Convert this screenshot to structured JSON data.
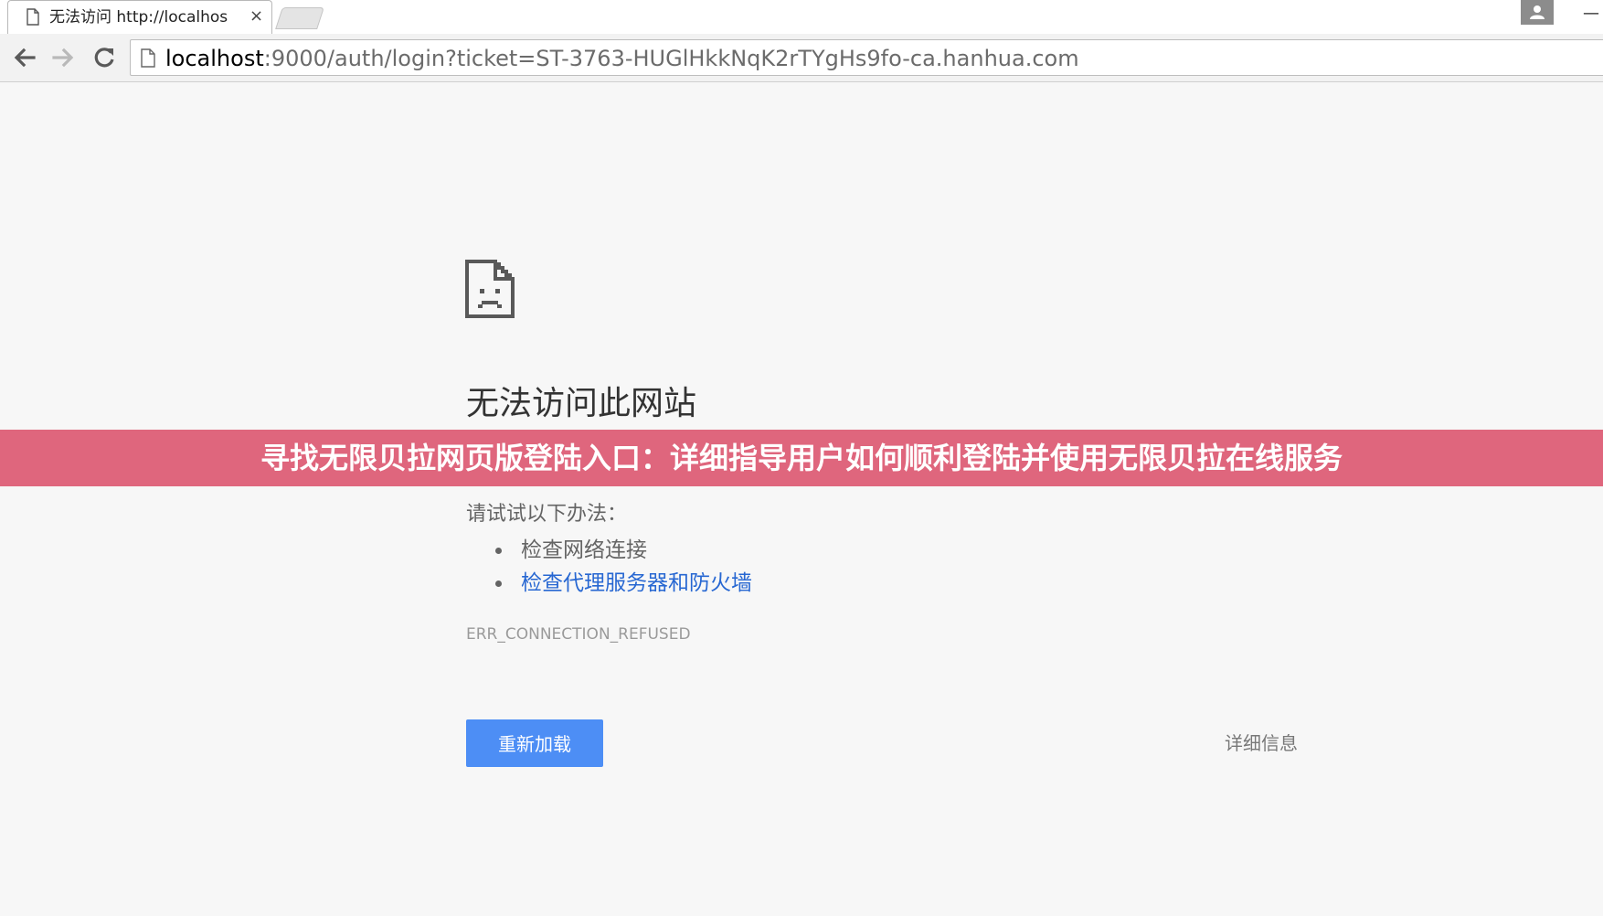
{
  "browser": {
    "tab": {
      "title": "无法访问 http://localhos",
      "close_glyph": "×",
      "icon": "file-icon"
    },
    "new_tab_icon": "new-tab-icon",
    "profile_icon": "user-icon",
    "minimize_glyph": "—",
    "nav": {
      "back_icon": "arrow-left-icon",
      "forward_icon": "arrow-right-icon",
      "reload_icon": "reload-icon"
    },
    "omnibox": {
      "icon": "page-icon",
      "url_host": "localhost",
      "url_rest": ":9000/auth/login?ticket=ST-3763-HUGlHkkNqK2rTYgHs9fo-ca.hanhua.com"
    }
  },
  "error_page": {
    "icon": "sad-document-icon",
    "title": "无法访问此网站",
    "subtitle": "",
    "suggest_heading": "请试试以下办法：",
    "suggestions": [
      {
        "label": "检查网络连接",
        "link": false
      },
      {
        "label": "检查代理服务器和防火墙",
        "link": true
      }
    ],
    "error_code": "ERR_CONNECTION_REFUSED",
    "reload_label": "重新加载",
    "details_label": "详细信息"
  },
  "overlay": {
    "text": "寻找无限贝拉网页版登陆入口：详细指导用户如何顺利登陆并使用无限贝拉在线服务"
  },
  "colors": {
    "link": "#2767d2",
    "button": "#4d8ef5",
    "banner": "#dd5a73"
  }
}
